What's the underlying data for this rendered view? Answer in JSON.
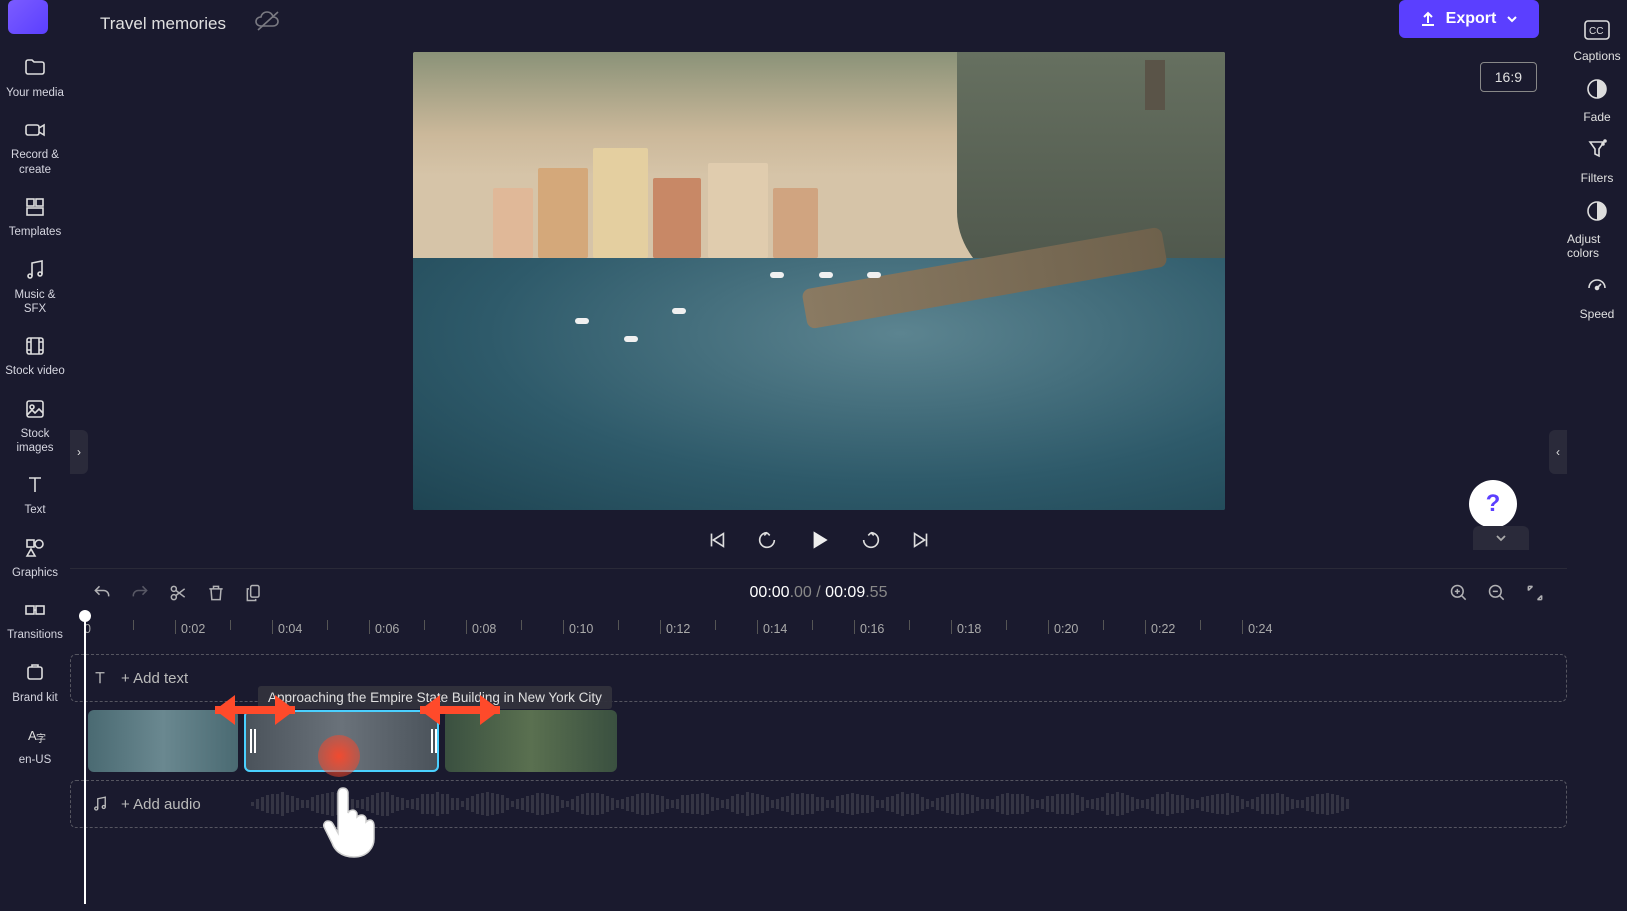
{
  "project": {
    "title": "Travel memories",
    "aspect": "16:9"
  },
  "export": {
    "label": "Export"
  },
  "left_sidebar": {
    "items": [
      {
        "label": "Your media",
        "icon": "folder-icon"
      },
      {
        "label": "Record & create",
        "icon": "camera-icon"
      },
      {
        "label": "Templates",
        "icon": "templates-icon"
      },
      {
        "label": "Music & SFX",
        "icon": "music-icon"
      },
      {
        "label": "Stock video",
        "icon": "film-icon"
      },
      {
        "label": "Stock images",
        "icon": "image-icon"
      },
      {
        "label": "Text",
        "icon": "text-icon"
      },
      {
        "label": "Graphics",
        "icon": "graphics-icon"
      },
      {
        "label": "Transitions",
        "icon": "transitions-icon"
      },
      {
        "label": "Brand kit",
        "icon": "brand-icon"
      },
      {
        "label": "en-US",
        "icon": "language-icon"
      }
    ]
  },
  "right_sidebar": {
    "items": [
      {
        "label": "Captions",
        "icon": "cc-icon"
      },
      {
        "label": "Fade",
        "icon": "fade-icon"
      },
      {
        "label": "Filters",
        "icon": "filters-icon"
      },
      {
        "label": "Adjust colors",
        "icon": "adjust-icon"
      },
      {
        "label": "Speed",
        "icon": "speed-icon"
      }
    ]
  },
  "time": {
    "current": "00:00",
    "current_frac": ".00",
    "sep": " / ",
    "total": "00:09",
    "total_frac": ".55"
  },
  "ruler": {
    "marks": [
      "0",
      "0:02",
      "0:04",
      "0:06",
      "0:08",
      "0:10",
      "0:12",
      "0:14",
      "0:16",
      "0:18",
      "0:20",
      "0:22",
      "0:24"
    ]
  },
  "tracks": {
    "text_hint": "+ Add text",
    "audio_hint": "+ Add audio",
    "tooltip": "Approaching the Empire State Building in New York City"
  },
  "help": {
    "label": "?"
  }
}
